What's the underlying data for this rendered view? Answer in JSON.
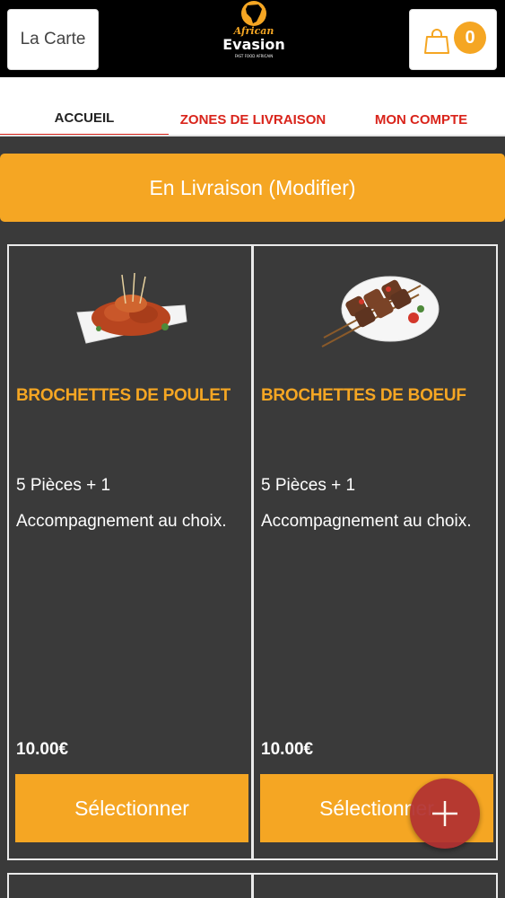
{
  "header": {
    "menu_label": "La Carte",
    "logo_line1": "African",
    "logo_line2": "Evasion",
    "logo_tagline": "FAST FOOD AFRICAIN",
    "cart_count": "0"
  },
  "tabs": [
    {
      "label": "ACCUEIL",
      "active": true
    },
    {
      "label": "ZONES DE LIVRAISON",
      "active": false
    },
    {
      "label": "MON COMPTE",
      "active": false
    }
  ],
  "delivery": {
    "label": "En Livraison (Modifier)"
  },
  "products": [
    {
      "title": "BROCHETTES DE POULET",
      "desc_line1": "5 Pièces  + 1",
      "desc_line2": "Accompagnement au choix.",
      "price": "10.00€",
      "button": "Sélectionner",
      "image": "chicken-skewers-plate"
    },
    {
      "title": "BROCHETTES DE BOEUF",
      "desc_line1": "5 Pièces  + 1",
      "desc_line2": "Accompagnement au choix.",
      "price": "10.00€",
      "button": "Sélectionner",
      "image": "beef-skewers-plate"
    }
  ],
  "colors": {
    "accent": "#f5a623",
    "tab_red": "#d9241b",
    "background": "#3a3a3a",
    "fab": "#b23131"
  },
  "icons": {
    "cart": "shopping-bag-icon",
    "fab": "plus-icon"
  }
}
